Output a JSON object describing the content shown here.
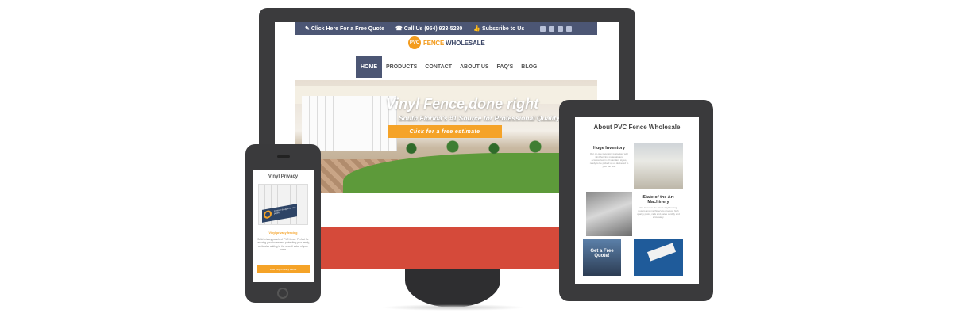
{
  "desktop": {
    "topbar": {
      "quote_link": "Click Here For a Free Quote",
      "phone": "Call Us (954) 933-5280",
      "subscribe": "Subscribe to Us",
      "social_icons": [
        "facebook-icon",
        "twitter-icon",
        "linkedin-icon",
        "email-icon"
      ]
    },
    "logo": {
      "mark": "PVC",
      "brand_a": "FENCE",
      "brand_b": "WHOLESALE"
    },
    "nav": [
      "HOME",
      "PRODUCTS",
      "CONTACT",
      "ABOUT US",
      "FAQ'S",
      "BLOG"
    ],
    "hero": {
      "title": "Vinyl Fence,done right",
      "subtitle": "South Florida's #1 Source for Professional Quality Vinyl Fence",
      "cta": "Click for a free estimate"
    }
  },
  "tablet": {
    "title": "About PVC Fence Wholesale",
    "inventory_title": "Huge Inventory",
    "inventory_text": "Our on-site inventory is stocked with vinyl fencing materials and accessories in all standard styles, ready to be picked up or delivered to your job site.",
    "machinery_title": "State of the Art Machinery",
    "machinery_text": "We invest in the latest vinyl fencing routers and machinery to produce high quality posts, rails and gates quickly and accurately.",
    "quote_tile": "Get a Free Quote!"
  },
  "phone": {
    "title": "Vinyl Privacy",
    "badge_text": "Custom designs for any project",
    "subtitle": "Vinyl privacy fencing",
    "body": "Solid privacy panels of PVC fence. Perfect for securing your house and protecting your family, while also adding to the overall value of your home.",
    "button": "View Vinyl Privacy Fence"
  },
  "colors": {
    "navy": "#4c5674",
    "orange": "#f5a328",
    "red_accent": "#d54a3a",
    "device_frame": "#3a3a3c"
  }
}
